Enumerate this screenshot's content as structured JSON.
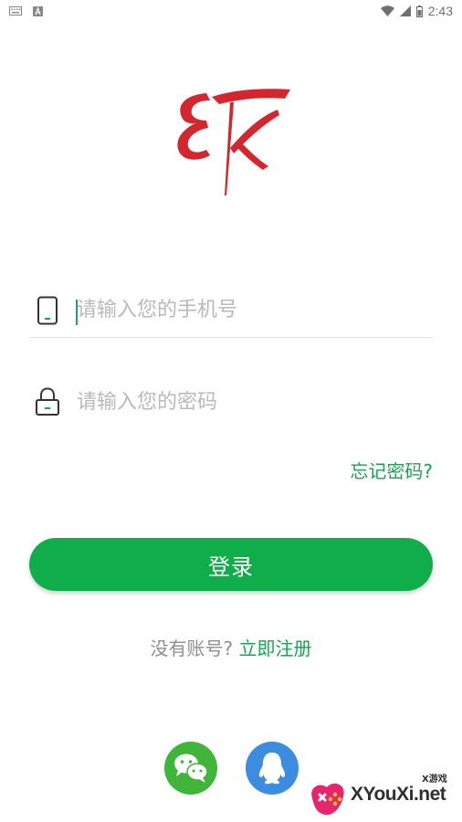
{
  "status_bar": {
    "time": "2:43"
  },
  "login": {
    "phone_placeholder": "请输入您的手机号",
    "password_placeholder": "请输入您的密码",
    "forgot_label": "忘记密码?",
    "login_label": "登录",
    "no_account_label": "没有账号?",
    "register_label": "立即注册"
  },
  "brand": {
    "logo_color": "#d4262e",
    "accent_color": "#0fae4b"
  },
  "social": {
    "wechat_color": "#3fb63a",
    "qq_color": "#3c8de0"
  },
  "watermark": {
    "text": "XYouXi.net",
    "small_text": "X游戏"
  }
}
